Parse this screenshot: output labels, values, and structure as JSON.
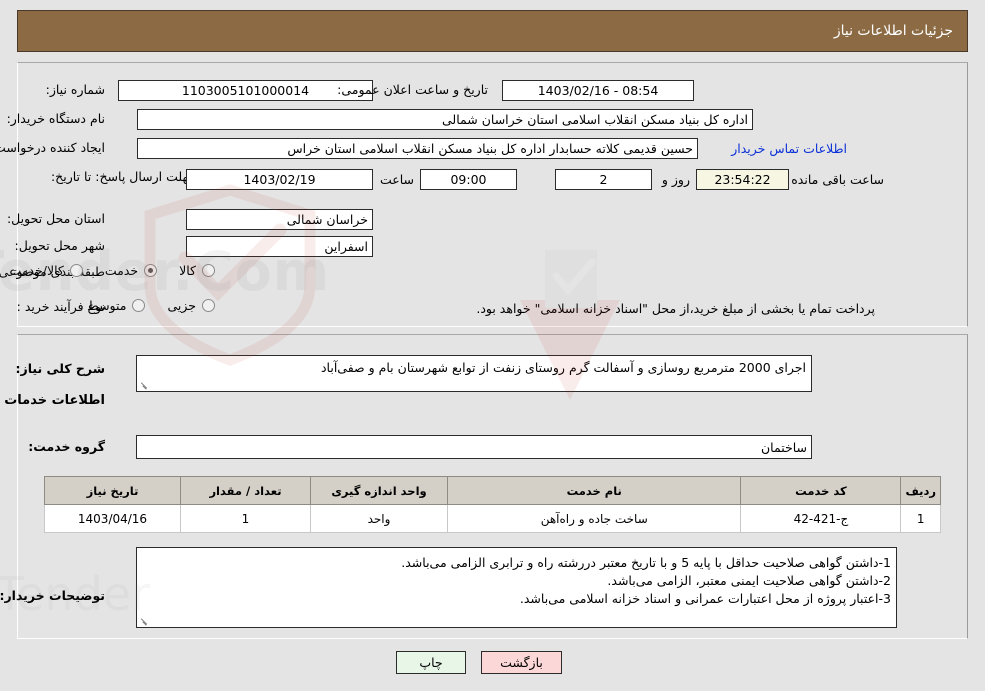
{
  "header": {
    "title": "جزئیات اطلاعات نیاز"
  },
  "top_form": {
    "need_number_label": "شماره نیاز:",
    "need_number_value": "1103005101000014",
    "announce_label": "تاریخ و ساعت اعلان عمومی:",
    "announce_value": "08:54 - 1403/02/16",
    "buyer_org_label": "نام دستگاه خریدار:",
    "buyer_org_value": "اداره کل بنیاد مسکن انقلاب اسلامی استان خراسان شمالی",
    "creator_label": "ایجاد کننده درخواست:",
    "creator_value": "حسین قدیمی کلاته حسابدار اداره کل بنیاد مسکن انقلاب اسلامی استان خراس",
    "contact_link": "اطلاعات تماس خریدار",
    "deadline_label": "مهلت ارسال پاسخ: تا تاریخ:",
    "deadline_date": "1403/02/19",
    "hour_label": "ساعت",
    "deadline_time": "09:00",
    "days_left": "2",
    "days_word": "روز و",
    "countdown": "23:54:22",
    "countdown_suffix": "ساعت باقی مانده",
    "province_label": "استان محل تحویل:",
    "province_value": "خراسان شمالی",
    "city_label": "شهر محل تحویل:",
    "city_value": "اسفراین",
    "category_label": "طبقه بندی موضوعی:",
    "category_options": [
      {
        "label": "کالا",
        "selected": false
      },
      {
        "label": "خدمت",
        "selected": true
      },
      {
        "label": "کالا/خدمت",
        "selected": false
      }
    ],
    "purchase_type_label": "نوع فرآیند خرید :",
    "purchase_type_options": [
      {
        "label": "جزیی",
        "selected": false
      },
      {
        "label": "متوسط",
        "selected": false
      }
    ],
    "treasury_note": "پرداخت تمام یا بخشی از مبلغ خرید،از محل \"اسناد خزانه اسلامی\" خواهد بود."
  },
  "description": {
    "label": "شرح کلی نیاز:",
    "value": "اجرای 2000 مترمربع روسازی و آسفالت گرم روستای زنفت از توابع شهرستان بام و صفی‌آباد"
  },
  "services_section": {
    "heading": "اطلاعات خدمات مورد نیاز",
    "group_label": "گروه خدمت:",
    "group_value": "ساختمان"
  },
  "table": {
    "columns": [
      "ردیف",
      "کد خدمت",
      "نام خدمت",
      "واحد اندازه گیری",
      "تعداد / مقدار",
      "تاریخ نیاز"
    ],
    "rows": [
      {
        "index": "1",
        "code": "ج-421-42",
        "name": "ساخت جاده و راه‌آهن",
        "unit": "واحد",
        "quantity": "1",
        "need_date": "1403/04/16"
      }
    ]
  },
  "buyer_notes": {
    "label": "توضیحات خریدار:",
    "lines": [
      "1-داشتن گواهی صلاحیت حداقل با پایه 5 و با تاریخ معتبر دررشته راه و ترابری الزامی می‌باشد.",
      "2-داشتن گواهی صلاحیت ایمنی معتبر، الزامی می‌باشد.",
      "3-اعتبار پروژه از محل اعتبارات عمرانی و اسناد خزانه اسلامی می‌باشد."
    ]
  },
  "buttons": {
    "print": "چاپ",
    "back": "بازگشت"
  },
  "colors": {
    "header_bg": "#8c6b44",
    "link": "#0b30d8",
    "countdown_bg": "#f7f6e3",
    "print_bg": "#e8f6e8",
    "back_bg": "#fbd7d7",
    "table_header_bg": "#d4d0c8"
  }
}
